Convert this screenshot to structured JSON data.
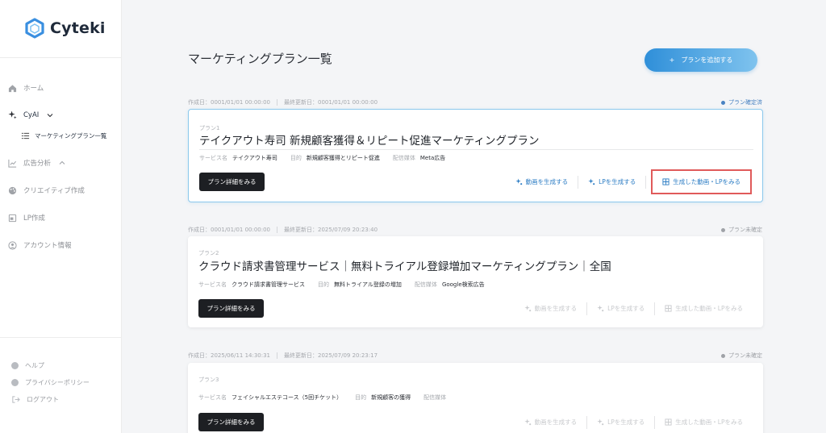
{
  "app": {
    "logo_text": "Cyteki"
  },
  "sidebar": {
    "items": [
      {
        "label": "ホーム",
        "icon": "home-icon"
      },
      {
        "label": "CyAI",
        "icon": "sparkle-icon",
        "expanded": true
      },
      {
        "label": "広告分析",
        "icon": "chart-icon",
        "expanded": true
      },
      {
        "label": "クリエイティブ作成",
        "icon": "palette-icon"
      },
      {
        "label": "LP作成",
        "icon": "page-icon"
      },
      {
        "label": "アカウント情報",
        "icon": "user-icon"
      }
    ],
    "sub_items": [
      {
        "label": "マーケティングプラン一覧",
        "icon": "list-icon"
      }
    ],
    "footer": [
      {
        "label": "ヘルプ",
        "icon": "help-icon"
      },
      {
        "label": "プライバシーポリシー",
        "icon": "info-icon"
      },
      {
        "label": "ログアウト",
        "icon": "logout-icon"
      }
    ]
  },
  "main": {
    "title": "マーケティングプラン一覧",
    "add_button": "プランを追加する",
    "labels": {
      "service": "サービス名",
      "purpose": "目的",
      "media": "配信媒体",
      "detail_button": "プラン詳細をみる",
      "gen_video": "動画を生成する",
      "gen_lp": "LPを生成する",
      "view_generated": "生成した動画・LPをみる"
    },
    "plans": [
      {
        "created": "作成日：0001/01/01 00:00:00",
        "updated": "最終更新日：0001/01/01 00:00:00",
        "status": "プラン確定済",
        "no": "プラン1",
        "title": "テイクアウト寿司 新規顧客獲得＆リピート促進マーケティングプラン",
        "service": "テイクアウト寿司",
        "purpose": "新規顧客獲得とリピート促進",
        "media": "Meta広告"
      },
      {
        "created": "作成日：0001/01/01 00:00:00",
        "updated": "最終更新日：2025/07/09 20:23:40",
        "status": "プラン未確定",
        "no": "プラン2",
        "title": "クラウド請求書管理サービス｜無料トライアル登録増加マーケティングプラン｜全国",
        "service": "クラウド請求書管理サービス",
        "purpose": "無料トライアル登録の増加",
        "media": "Google検索広告"
      },
      {
        "created": "作成日：2025/06/11 14:30:31",
        "updated": "最終更新日：2025/07/09 20:23:17",
        "status": "プラン未確定",
        "no": "プラン3",
        "title": "",
        "service": "フェイシャルエステコース（5回チケット）",
        "purpose": "新規顧客の獲得",
        "media": ""
      }
    ]
  }
}
